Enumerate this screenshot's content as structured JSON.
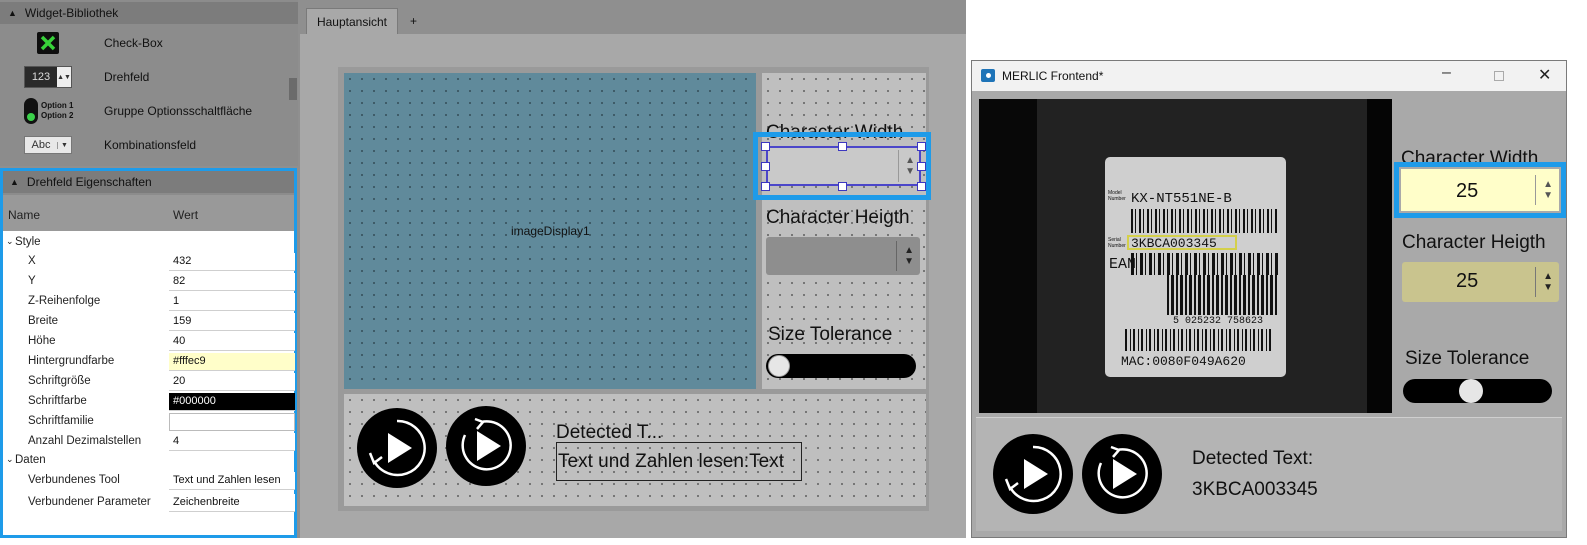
{
  "library": {
    "title": "Widget-Bibliothek",
    "items": [
      {
        "label": "Check-Box",
        "icon": "checkbox-icon"
      },
      {
        "label": "Drehfeld",
        "icon": "spinbox-icon",
        "sample": "123"
      },
      {
        "label": "Gruppe Optionsschaltfläche",
        "icon": "radio-group-icon",
        "opt1": "Option 1",
        "opt2": "Option 2"
      },
      {
        "label": "Kombinationsfeld",
        "icon": "combobox-icon",
        "sample": "Abc"
      }
    ]
  },
  "properties": {
    "title": "Drehfeld Eigenschaften",
    "col_name": "Name",
    "col_value": "Wert",
    "group_style": "Style",
    "group_data": "Daten",
    "rows": [
      {
        "name": "X",
        "value": "432"
      },
      {
        "name": "Y",
        "value": "82"
      },
      {
        "name": "Z-Reihenfolge",
        "value": "1"
      },
      {
        "name": "Breite",
        "value": "159"
      },
      {
        "name": "Höhe",
        "value": "40"
      },
      {
        "name": "Hintergrundfarbe",
        "value": "#fffec9"
      },
      {
        "name": "Schriftgröße",
        "value": "20"
      },
      {
        "name": "Schriftfarbe",
        "value": "#000000"
      },
      {
        "name": "Schriftfamilie",
        "value": ""
      },
      {
        "name": "Anzahl Dezimalstellen",
        "value": "4"
      }
    ],
    "data_rows": [
      {
        "name": "Verbundenes Tool",
        "value": "Text und Zahlen lesen"
      },
      {
        "name": "Verbundener Parameter",
        "value": "Zeichenbreite"
      }
    ]
  },
  "tabs": {
    "active": "Hauptansicht",
    "add": "+"
  },
  "design": {
    "image_label": "imageDisplay1",
    "char_width": "Character Width",
    "char_height": "Character Heigth",
    "size_tol": "Size Tolerance",
    "detected": "Detected T...",
    "bound_text": "Text und Zahlen lesen:Text"
  },
  "frontend": {
    "title": "MERLIC Frontend*",
    "char_width": "Character Width",
    "char_width_value": "25",
    "char_height": "Character Heigth",
    "char_height_value": "25",
    "size_tol": "Size Tolerance",
    "size_tol_level": 0.5,
    "detected": "Detected Text:",
    "result": "3KBCA003345",
    "label_text": {
      "model_caption": "Model Number",
      "model": "KX-NT551NE-B",
      "serial_caption": "Serial Number",
      "serial": "3KBCA003345",
      "ean": "EAN",
      "ean_number": "5 025232 758623",
      "mac": "MAC:0080F049A620"
    }
  },
  "colors": {
    "highlight": "#1e9be9",
    "image_bg": "#5f8a9a",
    "field_bg": "#fffec9",
    "field2_bg": "#c9c48e"
  }
}
